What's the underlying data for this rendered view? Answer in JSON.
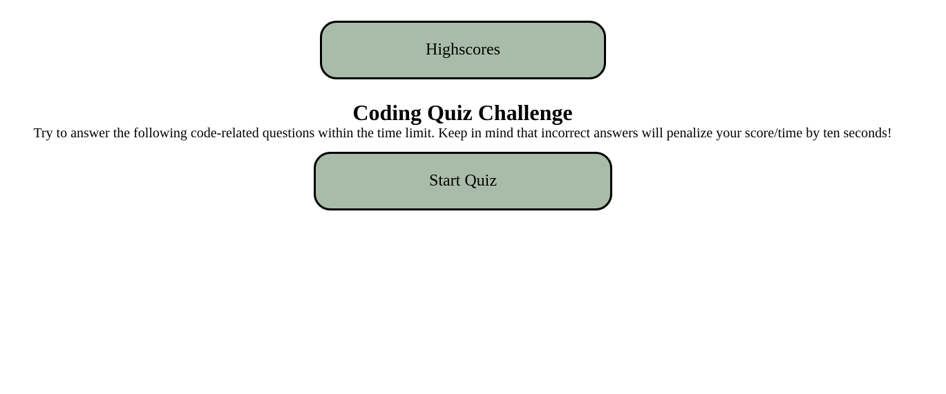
{
  "header": {
    "highscores_label": "Highscores"
  },
  "intro": {
    "title": "Coding Quiz Challenge",
    "instructions": "Try to answer the following code-related questions within the time limit. Keep in mind that incorrect answers will penalize your score/time by ten seconds!",
    "start_label": "Start Quiz"
  },
  "colors": {
    "button_background": "#a9bca9",
    "button_border": "#000000",
    "page_background": "#ffffff"
  }
}
